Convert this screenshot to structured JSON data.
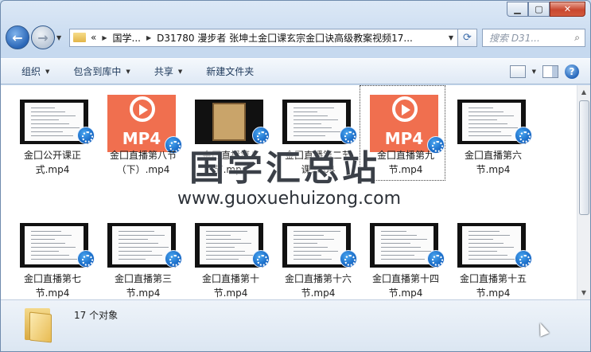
{
  "window": {
    "minimize": "▁",
    "maximize": "▢",
    "close": "✕"
  },
  "address": {
    "overflow": "«",
    "crumbs": [
      "国学...",
      "D31780 漫步者 张坤土金囗课玄宗金囗诀高级教案视频17..."
    ]
  },
  "search": {
    "placeholder": "搜索 D31..."
  },
  "toolbar": {
    "organize": "组织",
    "include": "包含到库中",
    "share": "共享",
    "new_folder": "新建文件夹"
  },
  "files": [
    {
      "name": "金囗公开课正式.mp4",
      "kind": "doc"
    },
    {
      "name": "金囗直播第八节（下）.mp4",
      "kind": "mp4"
    },
    {
      "name": "金囗直播第八节.mp4",
      "kind": "photo"
    },
    {
      "name": "金囗直播第二节课.mp4",
      "kind": "doc"
    },
    {
      "name": "金囗直播第九节.mp4",
      "kind": "mp4"
    },
    {
      "name": "金囗直播第六节.mp4",
      "kind": "doc"
    },
    {
      "name": "金囗直播第七节.mp4",
      "kind": "doc"
    },
    {
      "name": "金囗直播第三节.mp4",
      "kind": "doc"
    },
    {
      "name": "金囗直播第十节.mp4",
      "kind": "doc"
    },
    {
      "name": "金囗直播第十六节.mp4",
      "kind": "doc"
    },
    {
      "name": "金囗直播第十四节.mp4",
      "kind": "doc"
    },
    {
      "name": "金囗直播第十五节.mp4",
      "kind": "doc"
    }
  ],
  "mp4_label": "MP4",
  "watermark": {
    "title": "国学汇总站",
    "url": "www.guoxuehuizong.com"
  },
  "status": {
    "count": "17 个对象"
  },
  "colors": {
    "accent": "#2a66b7",
    "mp4": "#f06f4f"
  }
}
